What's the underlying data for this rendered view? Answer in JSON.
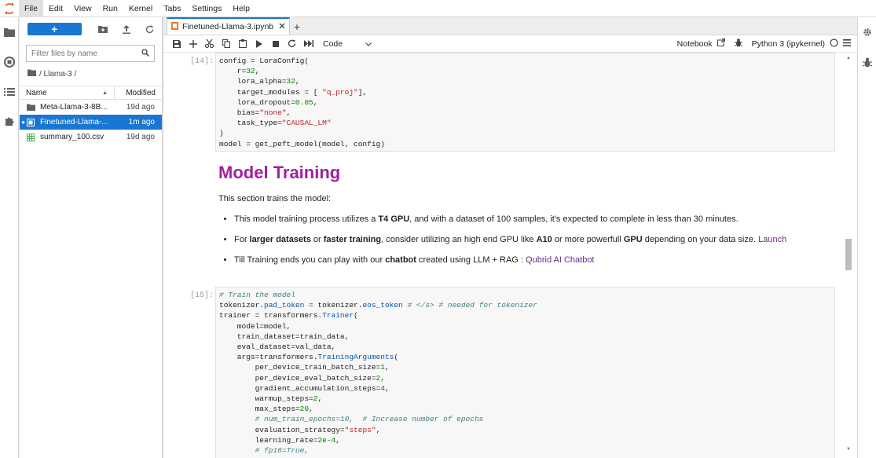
{
  "menubar": {
    "items": [
      "File",
      "Edit",
      "View",
      "Run",
      "Kernel",
      "Tabs",
      "Settings",
      "Help"
    ]
  },
  "filebrowser": {
    "new_label": "+",
    "filter_placeholder": "Filter files by name",
    "breadcrumb": "/ Llama-3 /",
    "col_name": "Name",
    "col_modified": "Modified",
    "files": [
      {
        "name": "Meta-Llama-3-8B...",
        "modified": "19d ago",
        "icon": "folder-icon"
      },
      {
        "name": "Finetuned-Llama-...",
        "modified": "1m ago",
        "icon": "notebook-icon",
        "selected": true
      },
      {
        "name": "summary_100.csv",
        "modified": "19d ago",
        "icon": "csv-icon"
      }
    ]
  },
  "tab": {
    "title": "Finetuned-Llama-3.ipynb"
  },
  "toolbar": {
    "cell_type": "Code",
    "notebook_label": "Notebook",
    "kernel_label": "Python 3 (ipykernel)"
  },
  "cells": {
    "c14_prompt": "[14]:",
    "c15_prompt": "[15]:",
    "md_heading": "Model Training",
    "md_intro": "This section trains the model:",
    "b1_pre": "This model training process utilizes a ",
    "b1_bold": "T4 GPU",
    "b1_post": ", and with a dataset of 100 samples, it's expected to complete in less than 30 minutes.",
    "b2_pre": "For ",
    "b2_bold1": "larger datasets",
    "b2_mid1": " or ",
    "b2_bold2": "faster training",
    "b2_mid2": ", consider utilizing an high end GPU like ",
    "b2_bold3": "A10",
    "b2_mid3": " or more powerfull ",
    "b2_bold4": "GPU",
    "b2_mid4": " depending on your data size. ",
    "b2_link": "Launch",
    "b3_pre": "Till Training ends you can play with our ",
    "b3_bold": "chatbot",
    "b3_mid": " created using LLM + RAG : ",
    "b3_link": "Qubrid AI Chatbot"
  },
  "colors": {
    "accent": "#1976d2",
    "heading": "#a020a0"
  }
}
